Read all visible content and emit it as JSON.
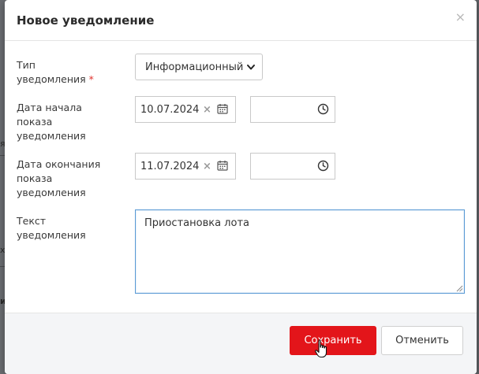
{
  "background_fragments": [
    "я",
    "х",
    "и"
  ],
  "modal": {
    "title": "Новое уведомление",
    "close_label": "×"
  },
  "form": {
    "type": {
      "label_line1": "Тип",
      "label_line2": "уведомления",
      "required_mark": "*",
      "selected": "Информационный"
    },
    "start": {
      "label_line1": "Дата начала",
      "label_line2": "показа",
      "label_line3": "уведомления",
      "date": "10.07.2024",
      "clear": "×",
      "time": ""
    },
    "end": {
      "label_line1": "Дата окончания",
      "label_line2": "показа",
      "label_line3": "уведомления",
      "date": "11.07.2024",
      "clear": "×",
      "time": ""
    },
    "text": {
      "label_line1": "Текст",
      "label_line2": "уведомления",
      "value": "Приостановка лота"
    }
  },
  "footer": {
    "save_label": "Сохранить",
    "cancel_label": "Отменить"
  },
  "colors": {
    "primary": "#e3151a",
    "focus_border": "#5b9bd5",
    "required": "#e0332e"
  }
}
